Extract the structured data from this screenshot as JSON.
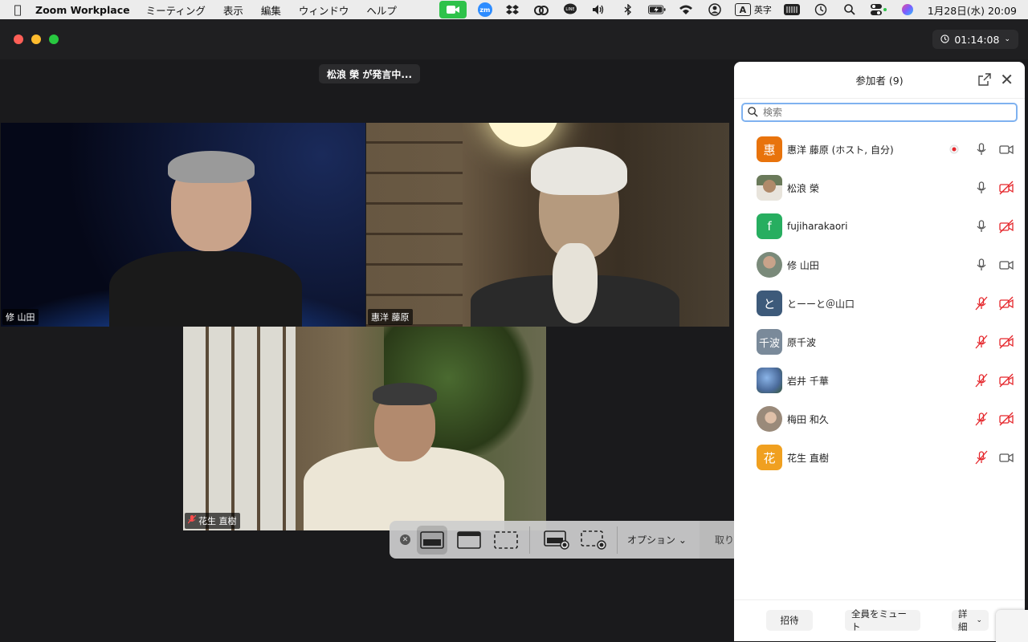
{
  "menubar": {
    "app": "Zoom Workplace",
    "menus": [
      "ミーティング",
      "表示",
      "編集",
      "ウィンドウ",
      "ヘルプ"
    ],
    "input_mode_letter": "A",
    "input_mode_label": "英字",
    "datetime": "1月28日(水)  20:09"
  },
  "meeting": {
    "timer": "01:14:08",
    "speaking": "松浪 榮 が発言中..."
  },
  "tiles": [
    {
      "name": "修 山田"
    },
    {
      "name": "惠洋 藤原"
    },
    {
      "name": "花生 直樹"
    }
  ],
  "capture_toolbar": {
    "options_label": "オプション",
    "capture_label": "取り込む"
  },
  "participants": {
    "title": "参加者 (9)",
    "search_placeholder": "検索",
    "list": [
      {
        "name": "惠洋 藤原 (ホスト, 自分)",
        "initial": "惠",
        "color": "#e8730c",
        "mic": "on",
        "cam": "on",
        "recording": true
      },
      {
        "name": "松浪 榮",
        "initial": "",
        "color": "#8a7a6a",
        "mic": "on",
        "cam": "off",
        "recording": false
      },
      {
        "name": "fujiharakaori",
        "initial": "f",
        "color": "#27ae60",
        "mic": "on",
        "cam": "off",
        "recording": false
      },
      {
        "name": "修 山田",
        "initial": "",
        "color": "#8a9a8a",
        "mic": "on",
        "cam": "on",
        "recording": false
      },
      {
        "name": "とーーと＠山口",
        "initial": "と",
        "color": "#3d5a7a",
        "mic": "off",
        "cam": "off",
        "recording": false
      },
      {
        "name": "原千波",
        "initial": "千波",
        "color": "#7a8a9a",
        "mic": "off",
        "cam": "off",
        "recording": false
      },
      {
        "name": "岩井 千華",
        "initial": "",
        "color": "#6a8aaa",
        "mic": "off",
        "cam": "off",
        "recording": false
      },
      {
        "name": "梅田 和久",
        "initial": "",
        "color": "#9a8a7a",
        "mic": "off",
        "cam": "off",
        "recording": false
      },
      {
        "name": "花生 直樹",
        "initial": "花",
        "color": "#f0a020",
        "mic": "off",
        "cam": "on",
        "recording": false
      }
    ],
    "footer": {
      "invite": "招待",
      "mute_all": "全員をミュート",
      "more": "詳細"
    }
  }
}
